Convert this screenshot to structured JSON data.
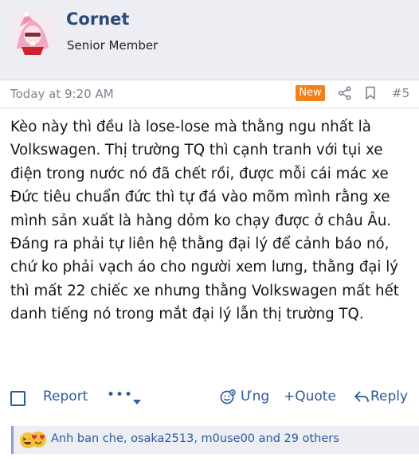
{
  "user": {
    "name": "Cornet",
    "title": "Senior Member"
  },
  "post": {
    "timestamp": "Today at 9:20 AM",
    "badge": "New",
    "number": "#5",
    "paragraphs": [
      "Kèo này thì đều là lose-lose mà thằng ngu nhất là Volkswagen. Thị trường TQ thì cạnh tranh với tụi xe điện trong nước nó đã chết rồi, được mỗi cái mác xe Đức tiêu chuẩn đức thì tự đá vào mõm mình rằng xe mình sản xuất là hàng dỏm ko chạy được ở châu Âu.",
      "Đáng ra phải tự liên hệ thằng đại lý để cảnh báo nó, chứ ko phải vạch áo cho người xem lưng, thằng đại lý thì mất 22 chiếc xe nhưng thằng Volkswagen mất hết danh tiếng nó trong mắt đại lý lẫn thị trường TQ."
    ]
  },
  "actions": {
    "report": "Report",
    "more": "•••",
    "react": "Ưng",
    "quote": "+Quote",
    "reply": "Reply"
  },
  "reactions": {
    "text": "Anh ban che, osaka2513, m0use00 and 29 others"
  },
  "colors": {
    "accent": "#2d5a9a",
    "username": "#2d4a76",
    "badge": "#f2811d",
    "header_bg": "#eceef3"
  },
  "icons": [
    "avatar",
    "share-icon",
    "bookmark-icon",
    "checkbox-icon",
    "chevron-down-icon",
    "reaction-smile-icon",
    "reply-arrow-icon",
    "reaction-haha-icon",
    "reaction-love-icon"
  ]
}
